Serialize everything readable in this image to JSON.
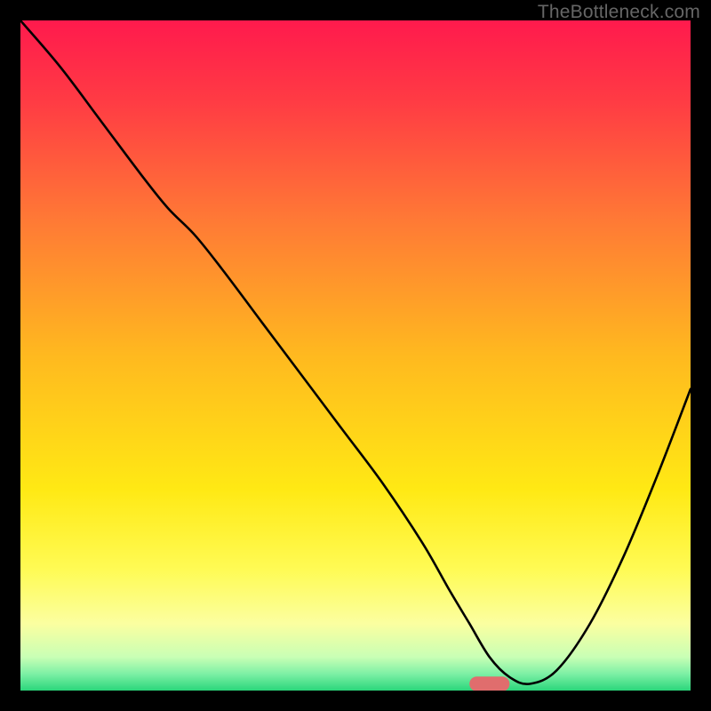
{
  "watermark": "TheBottleneck.com",
  "chart_data": {
    "type": "line",
    "title": "",
    "xlabel": "",
    "ylabel": "",
    "xlim": [
      0,
      100
    ],
    "ylim": [
      0,
      100
    ],
    "grid": false,
    "legend": false,
    "background_gradient": {
      "stops": [
        {
          "offset": 0.0,
          "color": "#ff1a4d"
        },
        {
          "offset": 0.12,
          "color": "#ff3b44"
        },
        {
          "offset": 0.3,
          "color": "#ff7a35"
        },
        {
          "offset": 0.5,
          "color": "#ffb91f"
        },
        {
          "offset": 0.7,
          "color": "#ffe914"
        },
        {
          "offset": 0.82,
          "color": "#fffb55"
        },
        {
          "offset": 0.9,
          "color": "#fbffa0"
        },
        {
          "offset": 0.95,
          "color": "#c9ffb5"
        },
        {
          "offset": 0.975,
          "color": "#7df0a5"
        },
        {
          "offset": 1.0,
          "color": "#2bd67b"
        }
      ]
    },
    "series": [
      {
        "name": "bottleneck-curve",
        "color": "#000000",
        "width": 2.6,
        "x": [
          0,
          6,
          12,
          18,
          22,
          26,
          30,
          36,
          42,
          48,
          54,
          60,
          64,
          67,
          70,
          73,
          76,
          80,
          85,
          90,
          95,
          100
        ],
        "y": [
          100,
          93,
          85,
          77,
          72,
          68,
          63,
          55,
          47,
          39,
          31,
          22,
          15,
          10,
          5,
          2,
          1,
          3,
          10,
          20,
          32,
          45
        ]
      }
    ],
    "marker": {
      "name": "optimal-point",
      "shape": "pill",
      "color": "#e06d6d",
      "x_center": 70,
      "y": 1,
      "width_x": 6,
      "height_y": 2.2
    }
  }
}
